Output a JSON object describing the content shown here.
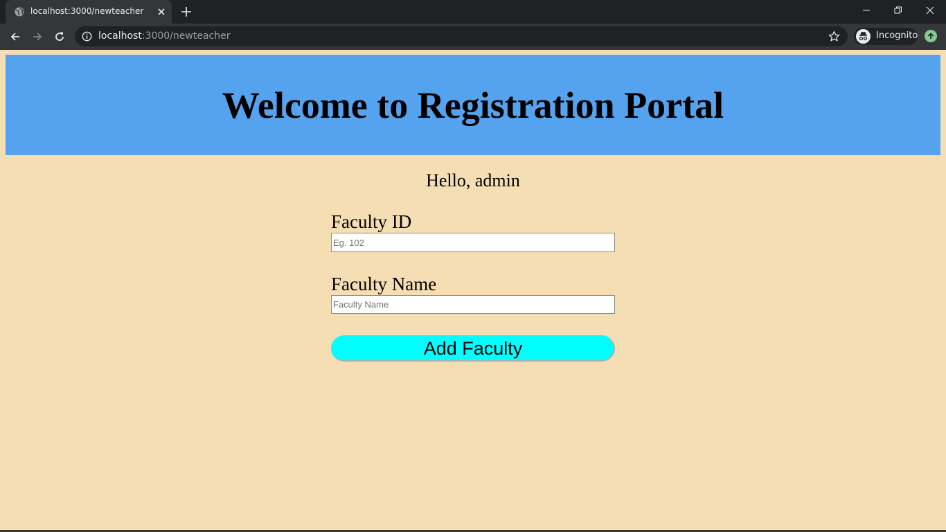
{
  "browser": {
    "tab_title": "localhost:3000/newteacher",
    "url_host": "localhost",
    "url_path": ":3000/newteacher",
    "profile_label": "Incognito",
    "icons": [
      "globe-icon",
      "close-icon",
      "plus-icon",
      "minimize-icon",
      "restore-icon",
      "window-close-icon",
      "back-arrow-icon",
      "forward-arrow-icon",
      "reload-icon",
      "info-icon",
      "star-icon",
      "incognito-icon",
      "update-icon"
    ]
  },
  "page": {
    "title": "Welcome to Registration Portal",
    "greeting": "Hello, admin",
    "form": {
      "faculty_id_label": "Faculty ID",
      "faculty_id_placeholder": "Eg. 102",
      "faculty_name_label": "Faculty Name",
      "faculty_name_placeholder": "Faculty Name",
      "submit_label": "Add Faculty"
    }
  },
  "colors": {
    "page_background": "#f5deb3",
    "header_background": "#55a3ef",
    "button_background": "#00ffff",
    "chrome_dark": "#202124",
    "chrome_toolbar": "#35363a"
  }
}
